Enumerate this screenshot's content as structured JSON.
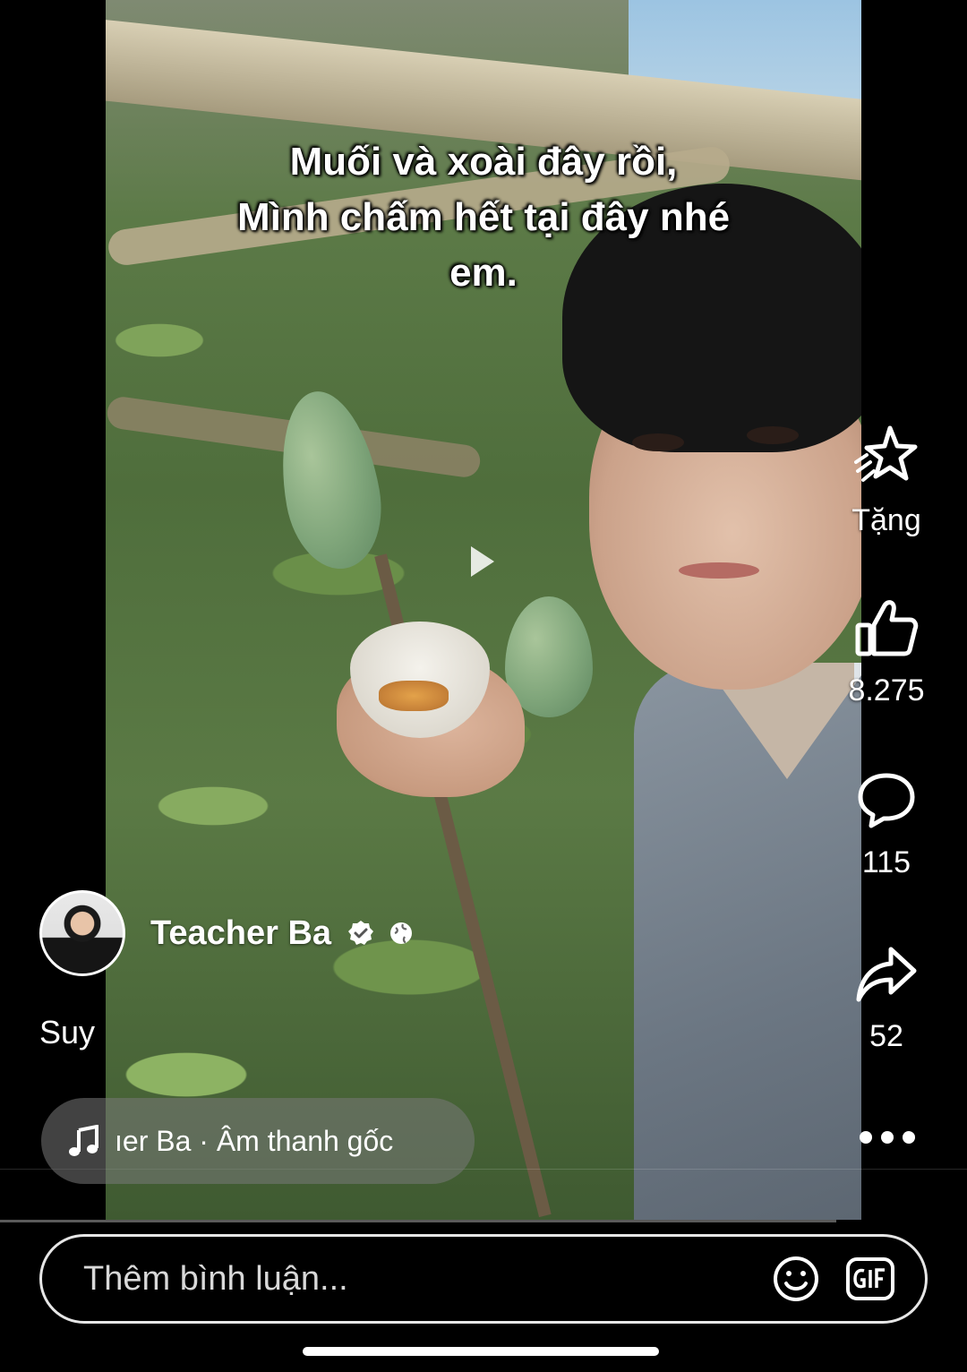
{
  "video": {
    "caption": "Muối và xoài đây rồi,\nMình chấm hết tại đây nhé\nem."
  },
  "actions": {
    "gift_label": "Tặng",
    "like_count": "8.275",
    "comment_count": "115",
    "share_count": "52"
  },
  "author": {
    "name": "Teacher Ba"
  },
  "post": {
    "description": "Suy"
  },
  "audio": {
    "text": "ıer Ba · Âm thanh gốc"
  },
  "comment": {
    "placeholder": "Thêm bình luận..."
  },
  "icons": {
    "gift": "star-gift-icon",
    "like": "thumbs-up-icon",
    "comment": "speech-bubble-icon",
    "share": "share-arrow-icon",
    "more": "ellipsis-icon",
    "verified": "verified-badge-icon",
    "privacy": "globe-icon",
    "music": "music-note-icon",
    "emoji": "smiley-icon",
    "gif": "gif-icon",
    "play": "play-icon"
  }
}
